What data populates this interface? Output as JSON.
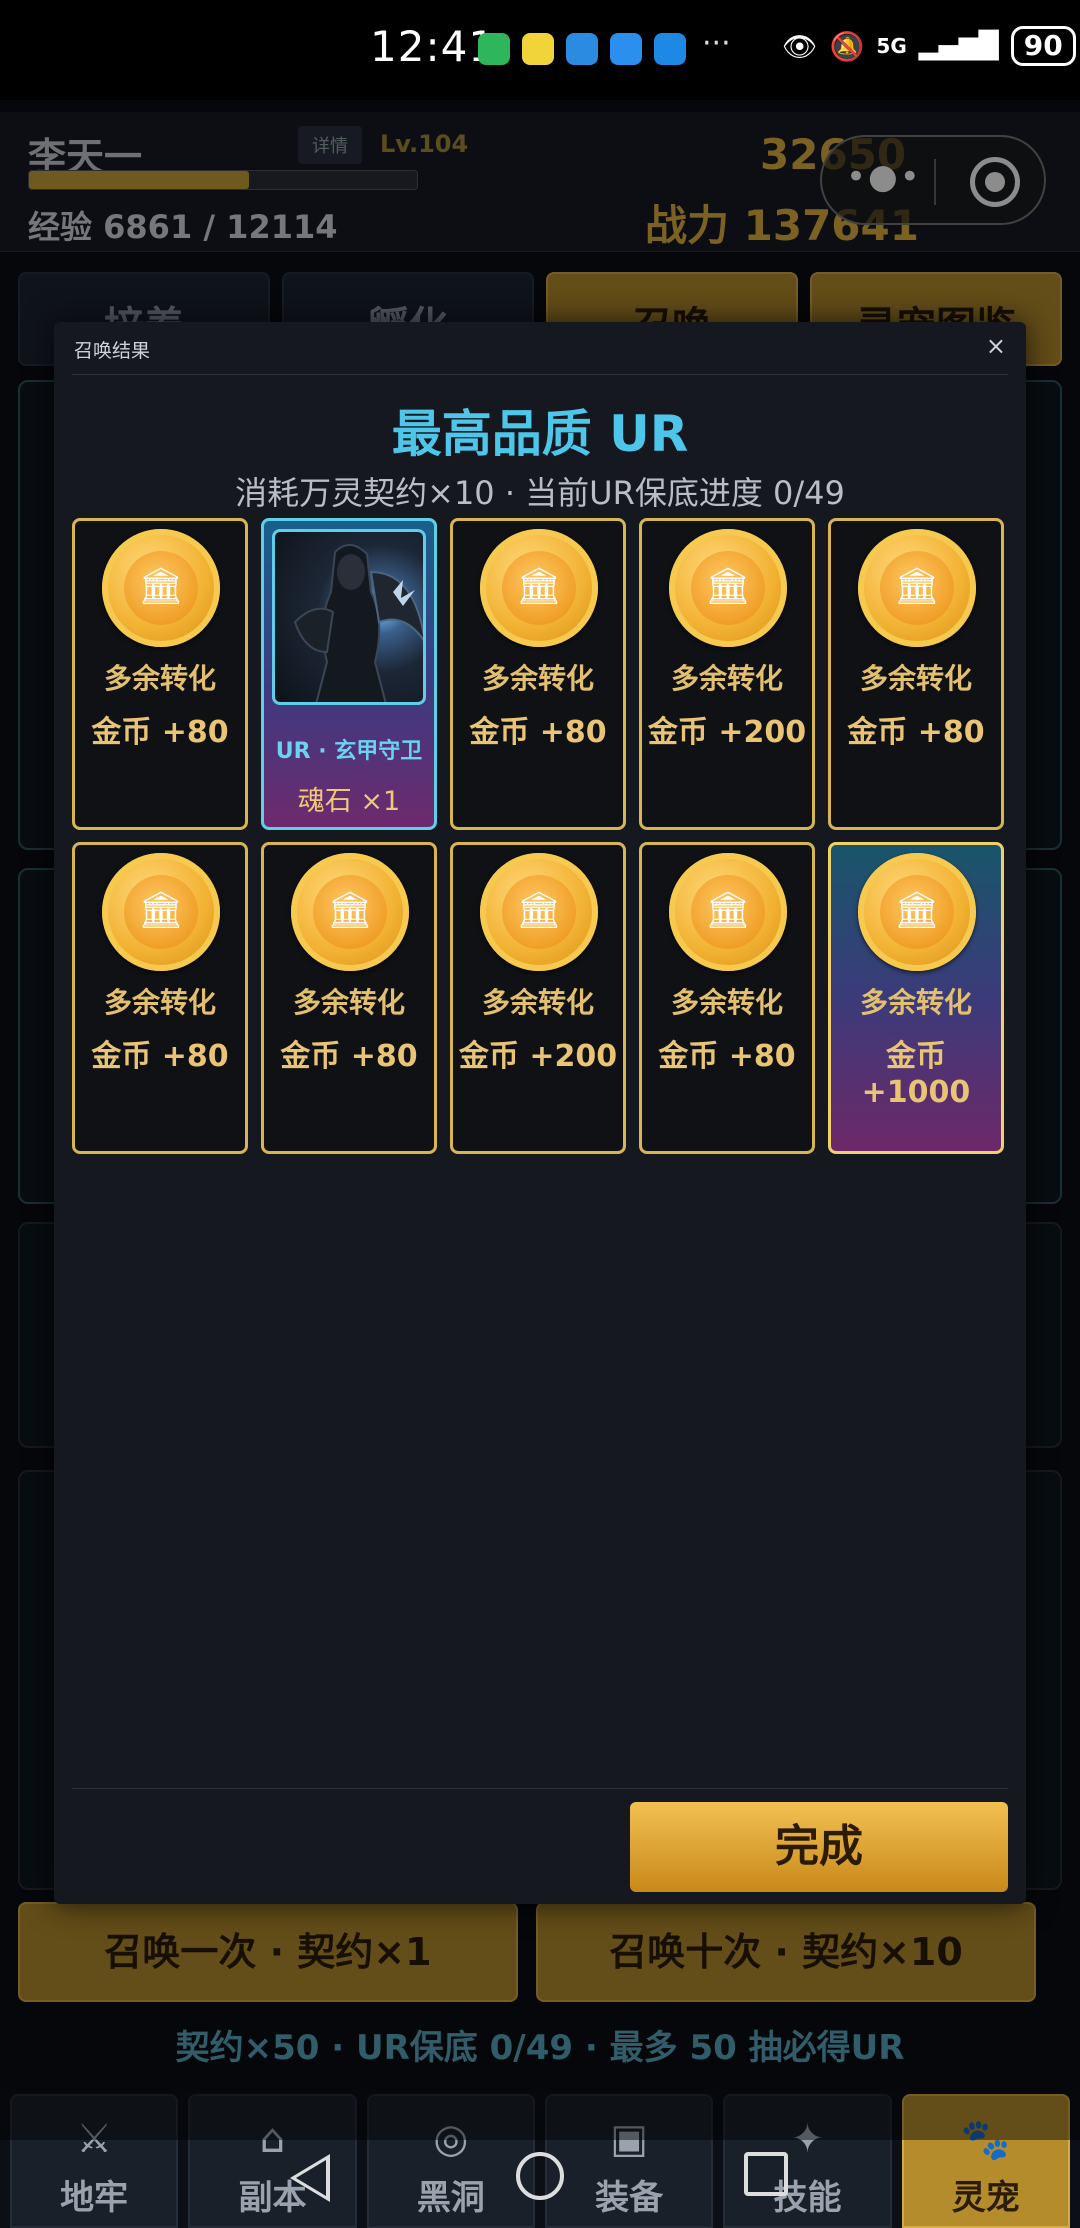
{
  "status_bar": {
    "time": "12:41",
    "more": "···",
    "network": "5G",
    "battery": "90"
  },
  "header": {
    "player_name": "李天一",
    "detail_button": "详情",
    "level": "Lv.104",
    "xp_text": "经验 6861 / 12114",
    "xp_progress": 0.566,
    "gold": "32650",
    "power": "战力 137641"
  },
  "tabs": [
    {
      "label": "培养",
      "active": false
    },
    {
      "label": "孵化",
      "active": false
    },
    {
      "label": "召唤",
      "active": true
    },
    {
      "label": "灵宠图鉴",
      "active": true
    }
  ],
  "summon_buttons": {
    "single": "召唤一次 · 契约×1",
    "ten": "召唤十次 · 契约×10"
  },
  "summon_info": "契约×50 · UR保底 0/49 · 最多 50 抽必得UR",
  "bottom_nav": [
    {
      "label": "地牢",
      "icon": "sword-icon",
      "active": false
    },
    {
      "label": "副本",
      "icon": "gate-icon",
      "active": false
    },
    {
      "label": "黑洞",
      "icon": "vortex-icon",
      "active": false
    },
    {
      "label": "装备",
      "icon": "bag-icon",
      "active": false
    },
    {
      "label": "技能",
      "icon": "star-icon",
      "active": false
    },
    {
      "label": "灵宠",
      "icon": "paw-icon",
      "active": true
    }
  ],
  "modal": {
    "title": "召唤结果",
    "close": "×",
    "heading": "最高品质 UR",
    "subtitle": "消耗万灵契约×10 · 当前UR保底进度 0/49",
    "done_button": "完成",
    "results": [
      {
        "type": "coin",
        "label": "多余转化",
        "value": "金币 +80"
      },
      {
        "type": "pet",
        "name": "UR · 玄甲守卫",
        "qty": "魂石 ×1"
      },
      {
        "type": "coin",
        "label": "多余转化",
        "value": "金币 +80"
      },
      {
        "type": "coin",
        "label": "多余转化",
        "value": "金币 +200"
      },
      {
        "type": "coin",
        "label": "多余转化",
        "value": "金币 +80"
      },
      {
        "type": "coin",
        "label": "多余转化",
        "value": "金币 +80"
      },
      {
        "type": "coin",
        "label": "多余转化",
        "value": "金币 +80"
      },
      {
        "type": "coin",
        "label": "多余转化",
        "value": "金币 +200"
      },
      {
        "type": "coin",
        "label": "多余转化",
        "value": "金币 +80"
      },
      {
        "type": "coin",
        "label": "多余转化",
        "value": "金币 +1000",
        "highlight": true
      }
    ]
  },
  "colors": {
    "gold_accent": "#d7b652",
    "ur_cyan": "#4ec6ea",
    "button_gold": "#e0a83a"
  }
}
